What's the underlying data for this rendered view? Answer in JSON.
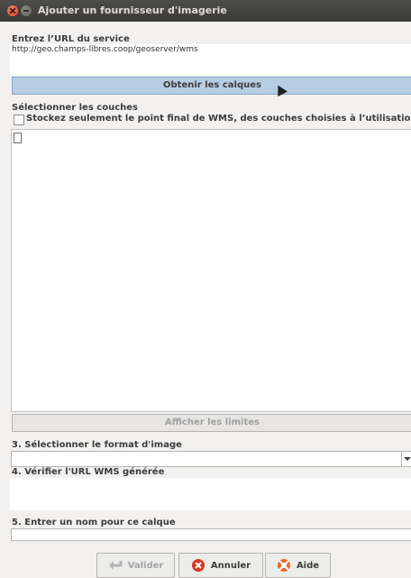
{
  "window": {
    "title": "Ajouter un fournisseur d'imagerie"
  },
  "service": {
    "label": "Entrez l’URL du service",
    "url_value": "http://geo.champs-libres.coop/geoserver/wms"
  },
  "get_layers_button": "Obtenir les calques",
  "layers": {
    "label": "Sélectionner les couches",
    "store_checkbox": "Stockez seulement le point final de WMS, des couches choisies à l’utilisation",
    "show_bounds_button": "Afficher les limites"
  },
  "image_format": {
    "label": "3. Sélectionner le format d'image",
    "value": ""
  },
  "generated_url": {
    "label": "4. Vérifier l'URL WMS générée",
    "value": ""
  },
  "layer_name": {
    "label": "5. Entrer un nom pour ce calque",
    "value": ""
  },
  "footer": {
    "validate_label": "Valider",
    "cancel_label": "Annuler",
    "help_label": "Aide"
  },
  "icons": {
    "close": "close-icon",
    "minimize": "minimize-icon",
    "file": "file-icon",
    "validate": "check-arrow-icon",
    "cancel": "cancel-icon",
    "help": "lifebuoy-icon"
  },
  "colors": {
    "titlebar": "#3a3a37",
    "hover_button": "#b7cde3",
    "cancel": "#d7361e",
    "help": "#e86b2f"
  }
}
